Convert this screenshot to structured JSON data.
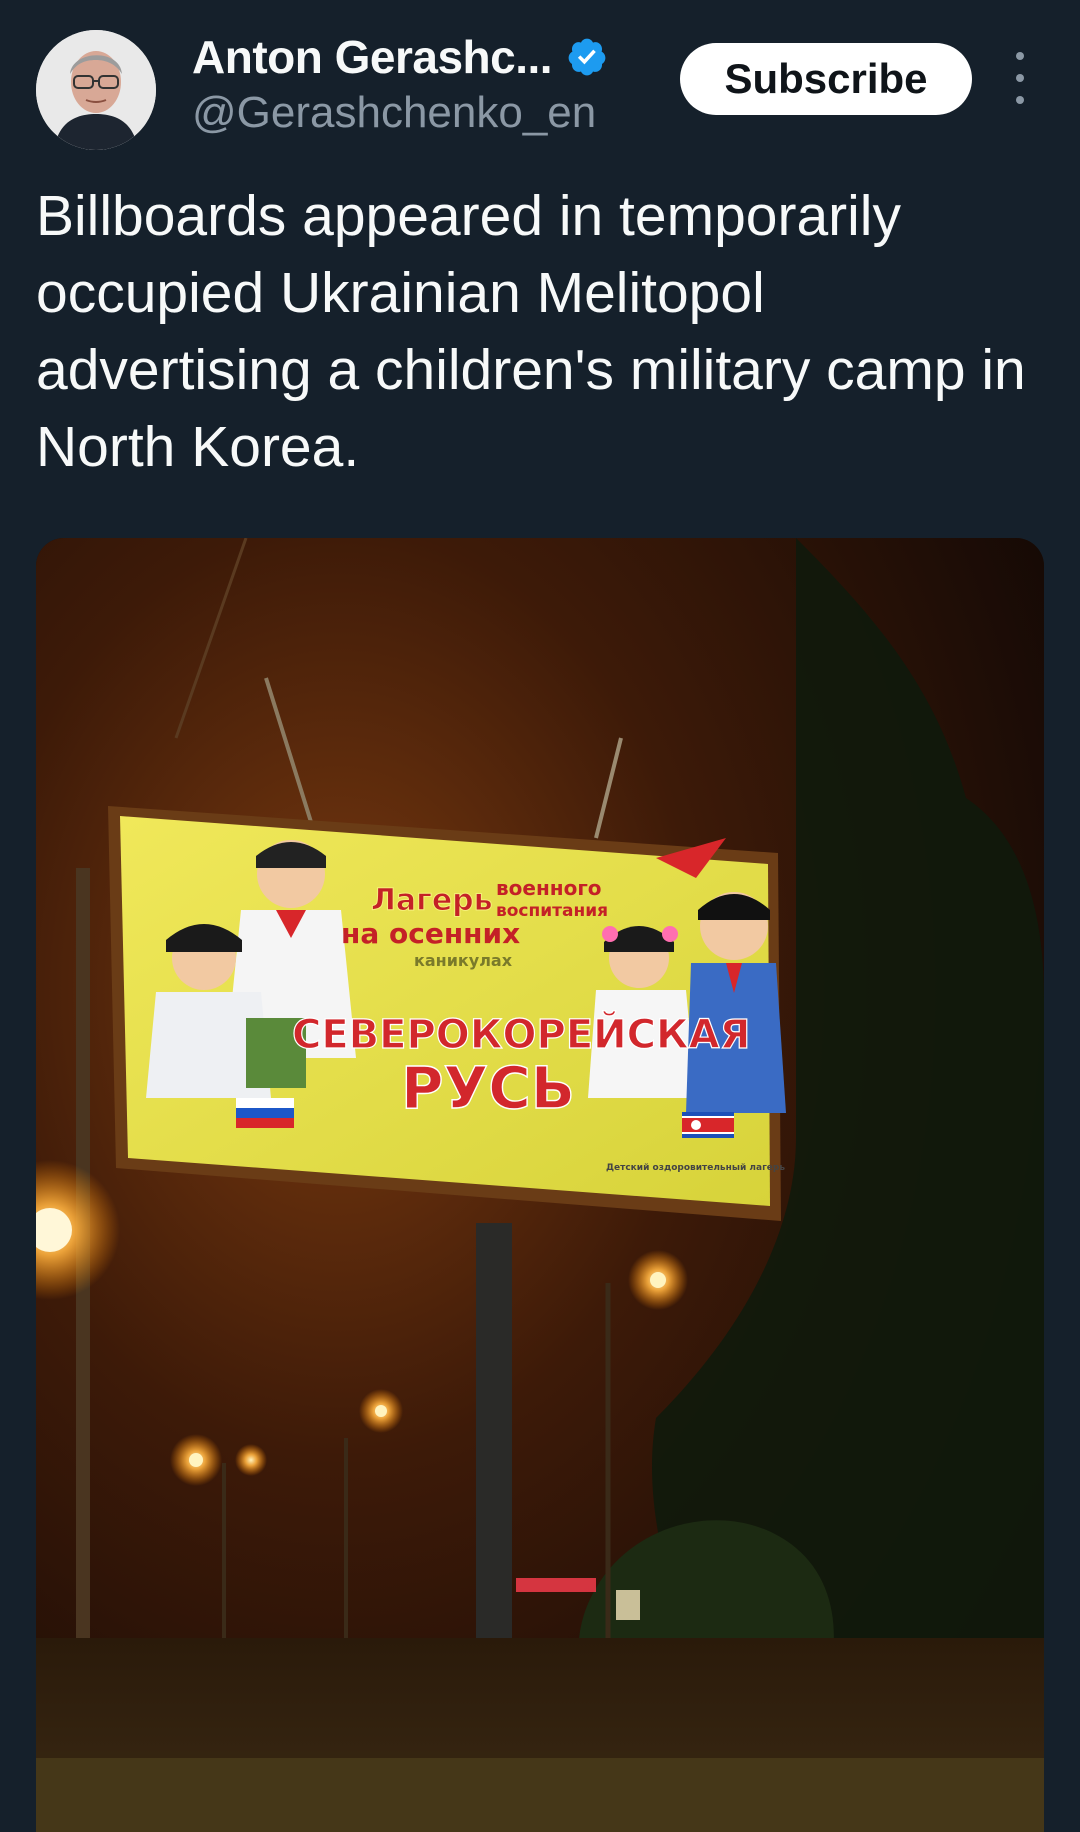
{
  "author": {
    "name": "Anton Gerashc...",
    "handle": "@Gerashchenko_en",
    "verified": true
  },
  "actions": {
    "subscribe_label": "Subscribe"
  },
  "tweet": {
    "text": "Billboards appeared in temporarily occupied Ukrainian Melitopol advertising a children's military camp in North Korea."
  },
  "billboard": {
    "line_top_left": "Лагерь",
    "line_top_right_1": "военного",
    "line_top_right_2": "воспитания",
    "line_second": "на осенних",
    "line_third": "каникулах",
    "headline_1": "СЕВЕРОКОРЕЙСКАЯ",
    "headline_2": "РУСЬ",
    "footer_right": "Детский оздоровительный лагерь"
  },
  "colors": {
    "background": "#15202b",
    "verified_badge": "#1d9bf0",
    "secondary_text": "#8b98a5",
    "billboard_yellow": "#e9e34a",
    "billboard_red": "#c8282d"
  },
  "icons": {
    "verified": "verified-badge-icon",
    "more": "more-vertical-icon"
  }
}
